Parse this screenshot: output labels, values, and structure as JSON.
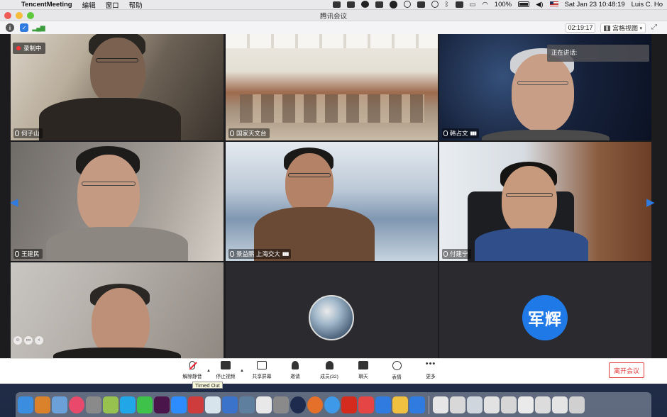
{
  "menubar": {
    "app_name": "TencentMeeting",
    "menus": [
      "编辑",
      "窗口",
      "帮助"
    ],
    "battery": "100%",
    "datetime": "Sat Jan 23  10:48:19",
    "user": "Luis C. Ho"
  },
  "window": {
    "title": "腾讯会议"
  },
  "toolbar": {
    "elapsed": "02:19:17",
    "view_mode": "宫格视图"
  },
  "tiles": [
    {
      "name": "何子山",
      "recording": "录制中"
    },
    {
      "name": "国家天文台"
    },
    {
      "name": "韩占文",
      "speaking_label": "正在讲话:"
    },
    {
      "name": "王建民"
    },
    {
      "name": "景益鹏 上海交大"
    },
    {
      "name": "付建宁"
    },
    {
      "name": ""
    },
    {
      "name": ""
    },
    {
      "name": "",
      "avatar_text": "军辉"
    }
  ],
  "controls": {
    "unmute": "解除静音",
    "stop_video": "停止视频",
    "share": "共享屏幕",
    "invite": "邀请",
    "members": "成员(32)",
    "chat": "聊天",
    "emoji": "表情",
    "more": "更多",
    "leave": "离开会议",
    "tooltip": "Timed Out"
  },
  "colors": {
    "accent": "#1f7ae8",
    "leave": "#e23b3b",
    "recording": "#ff3333"
  }
}
